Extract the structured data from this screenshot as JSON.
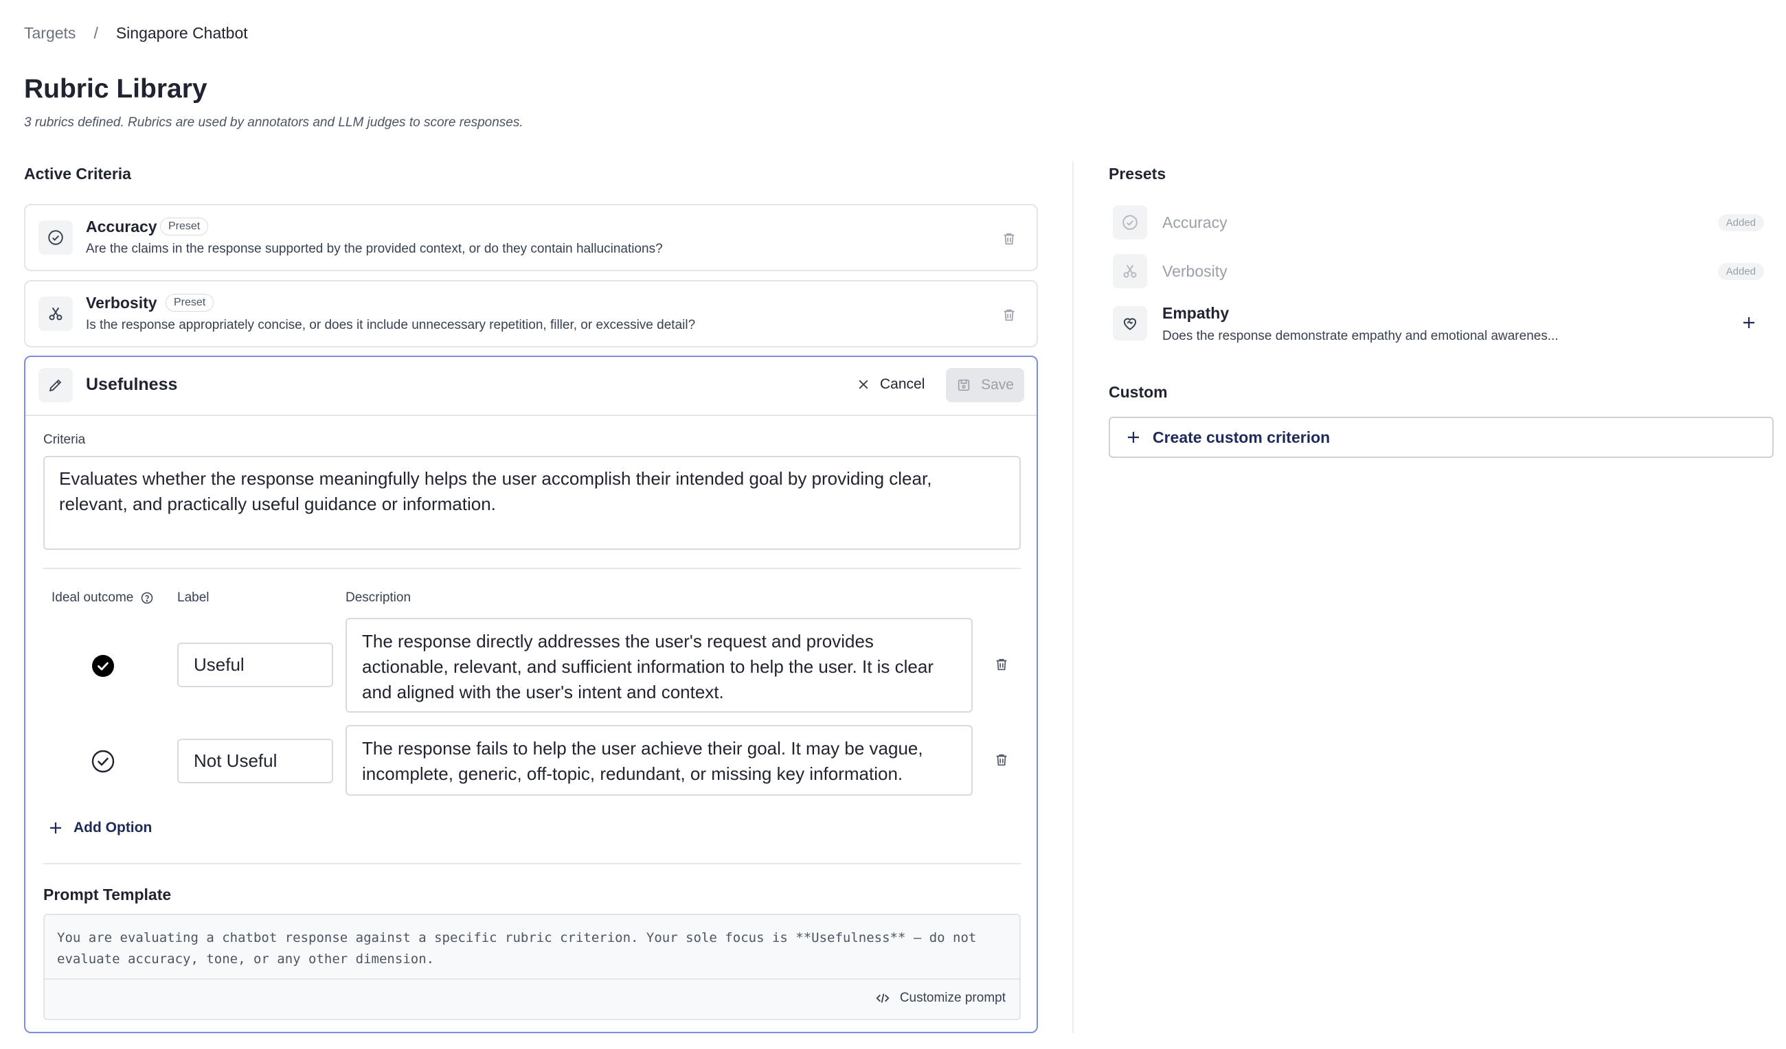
{
  "breadcrumb": {
    "parent": "Targets",
    "separator": "/",
    "current": "Singapore Chatbot"
  },
  "page": {
    "title": "Rubric Library",
    "subtitle": "3 rubrics defined. Rubrics are used by annotators and LLM judges to score responses."
  },
  "active": {
    "title": "Active Criteria",
    "items": [
      {
        "name": "Accuracy",
        "badge": "Preset",
        "icon": "check-circle-icon",
        "description": "Are the claims in the response supported by the provided context, or do they contain hallucinations?"
      },
      {
        "name": "Verbosity",
        "badge": "Preset",
        "icon": "scissors-icon",
        "description": "Is the response appropriately concise, or does it include unnecessary repetition, filler, or excessive detail?"
      }
    ]
  },
  "editor": {
    "name": "Usefulness",
    "icon": "pencil-icon",
    "cancel_label": "Cancel",
    "save_label": "Save",
    "criteria_label": "Criteria",
    "criteria_text": "Evaluates whether the response meaningfully helps the user accomplish their intended goal by providing clear, relevant, and practically useful guidance or information.",
    "columns": {
      "ideal": "Ideal outcome",
      "label": "Label",
      "description": "Description"
    },
    "options": [
      {
        "label": "Useful",
        "ideal": true,
        "description": "The response directly addresses the user's request and provides actionable, relevant, and sufficient information to help the user. It is clear and aligned with the user's intent and context."
      },
      {
        "label": "Not Useful",
        "ideal": false,
        "description": "The response fails to help the user achieve their goal. It may be vague, incomplete, generic, off-topic, redundant, or missing key information."
      }
    ],
    "add_option_label": "Add Option",
    "prompt_title": "Prompt Template",
    "prompt_text": "You are evaluating a chatbot response against a specific rubric criterion. Your sole focus is **Usefulness** — do not evaluate accuracy, tone, or any other dimension.",
    "customize_label": "Customize prompt"
  },
  "presets": {
    "title": "Presets",
    "items": [
      {
        "name": "Accuracy",
        "status": "Added",
        "icon": "check-circle-icon"
      },
      {
        "name": "Verbosity",
        "status": "Added",
        "icon": "scissors-icon"
      },
      {
        "name": "Empathy",
        "icon": "heart-handshake-icon",
        "description": "Does the response demonstrate empathy and emotional awarenes..."
      }
    ]
  },
  "custom": {
    "title": "Custom",
    "create_label": "Create custom criterion"
  },
  "colors": {
    "accent": "#1e2a5a",
    "edit_border": "#7d8de0",
    "muted": "#9aa0aa"
  }
}
